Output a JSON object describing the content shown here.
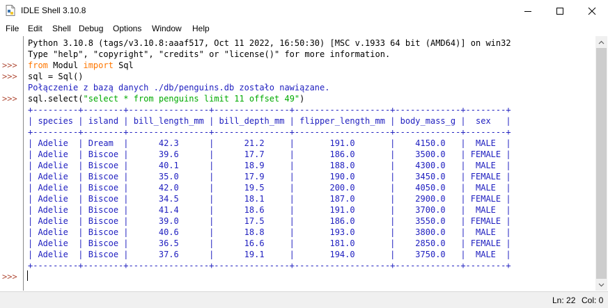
{
  "window": {
    "title": "IDLE Shell 3.10.8",
    "buttons": [
      "minimize",
      "maximize",
      "close"
    ]
  },
  "menu": [
    "File",
    "Edit",
    "Shell",
    "Debug",
    "Options",
    "Window",
    "Help"
  ],
  "prompt_symbol": ">>>",
  "console": {
    "banner1": "Python 3.10.8 (tags/v3.10.8:aaaf517, Oct 11 2022, 16:50:30) [MSC v.1933 64 bit (AMD64)] on win32",
    "banner2": "Type \"help\", \"copyright\", \"credits\" or \"license()\" for more information.",
    "cmd1_kw1": "from",
    "cmd1_mid": " Modul ",
    "cmd1_kw2": "import",
    "cmd1_end": " Sql",
    "cmd2": "sql = Sql()",
    "output1": "Połączenie z bazą danych ./db/penguins.db zostało nawiązane.",
    "cmd3_pre": "sql.select(",
    "cmd3_str": "\"select * from penguins limit 11 offset 49\"",
    "cmd3_post": ")",
    "table_border": "+---------+--------+----------------+---------------+-------------------+-------------+--------+",
    "table_header": "| species | island | bill_length_mm | bill_depth_mm | flipper_length_mm | body_mass_g |  sex   |",
    "table_rows": [
      "| Adelie  | Dream  |      42.3      |      21.2     |       191.0       |    4150.0   |  MALE  |",
      "| Adelie  | Biscoe |      39.6      |      17.7     |       186.0       |    3500.0   | FEMALE |",
      "| Adelie  | Biscoe |      40.1      |      18.9     |       188.0       |    4300.0   |  MALE  |",
      "| Adelie  | Biscoe |      35.0      |      17.9     |       190.0       |    3450.0   | FEMALE |",
      "| Adelie  | Biscoe |      42.0      |      19.5     |       200.0       |    4050.0   |  MALE  |",
      "| Adelie  | Biscoe |      34.5      |      18.1     |       187.0       |    2900.0   | FEMALE |",
      "| Adelie  | Biscoe |      41.4      |      18.6     |       191.0       |    3700.0   |  MALE  |",
      "| Adelie  | Biscoe |      39.0      |      17.5     |       186.0       |    3550.0   | FEMALE |",
      "| Adelie  | Biscoe |      40.6      |      18.8     |       193.0       |    3800.0   |  MALE  |",
      "| Adelie  | Biscoe |      36.5      |      16.6     |       181.0       |    2850.0   | FEMALE |",
      "| Adelie  | Biscoe |      37.6      |      19.1     |       194.0       |    3750.0   |  MALE  |"
    ]
  },
  "status": {
    "line": "Ln: 22",
    "col": "Col: 0"
  },
  "colors": {
    "keyword": "#ff7700",
    "string": "#00aa00",
    "output": "#2020c0",
    "prompt": "#b2503c"
  }
}
